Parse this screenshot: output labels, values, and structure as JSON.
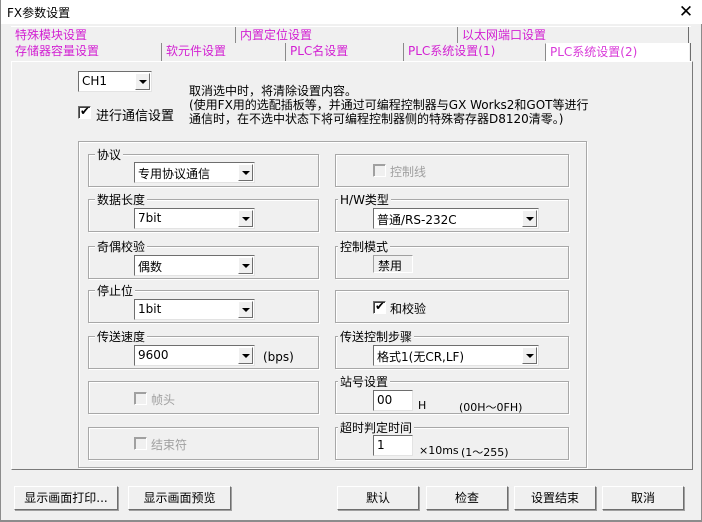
{
  "window": {
    "title": "FX参数设置",
    "close_icon": "close-icon"
  },
  "tabs": {
    "row1": [
      {
        "label": "特殊模块设置"
      },
      {
        "label": "内置定位设置"
      },
      {
        "label": "以太网端口设置"
      }
    ],
    "row2": [
      {
        "label": "存储器容量设置"
      },
      {
        "label": "软元件设置"
      },
      {
        "label": "PLC名设置"
      },
      {
        "label": "PLC系统设置(1)"
      },
      {
        "label": "PLC系统设置(2)",
        "active": true
      }
    ]
  },
  "channel": {
    "selected": "CH1"
  },
  "comm_setting": {
    "label": "进行通信设置",
    "checked": true
  },
  "description": {
    "line1": "取消选中时，将清除设置内容。",
    "line2": "(使用FX用的选配插板等，并通过可编程控制器与GX Works2和GOT等进行",
    "line3": "通信时，在不选中状态下将可编程控制器侧的特殊寄存器D8120清零。)"
  },
  "left": {
    "protocol": {
      "title": "协议",
      "value": "专用协议通信"
    },
    "data_length": {
      "title": "数据长度",
      "value": "7bit"
    },
    "parity": {
      "title": "奇偶校验",
      "value": "偶数"
    },
    "stop_bit": {
      "title": "停止位",
      "value": "1bit"
    },
    "baud_rate": {
      "title": "传送速度",
      "value": "9600",
      "unit": "(bps)"
    },
    "header": {
      "label": "帧头",
      "checked": false,
      "disabled": true
    },
    "terminator": {
      "label": "结束符",
      "checked": false,
      "disabled": true
    }
  },
  "right": {
    "control_line": {
      "label": "控制线",
      "checked": false,
      "disabled": true
    },
    "hw_type": {
      "title": "H/W类型",
      "value": "普通/RS-232C"
    },
    "control_mode": {
      "title": "控制模式",
      "value": "禁用"
    },
    "sum_check": {
      "label": "和校验",
      "checked": true
    },
    "transmission_procedure": {
      "title": "传送控制步骤",
      "value": "格式1(无CR,LF)"
    },
    "station_number": {
      "title": "站号设置",
      "value": "00",
      "unit": "H",
      "range": "(00H～0FH)"
    },
    "timeout": {
      "title": "超时判定时间",
      "value": "1",
      "unit": "×10ms",
      "range": "(1～255)"
    }
  },
  "buttons": {
    "print": "显示画面打印...",
    "preview": "显示画面预览",
    "default": "默认",
    "check": "检查",
    "finish": "设置结束",
    "cancel": "取消"
  }
}
